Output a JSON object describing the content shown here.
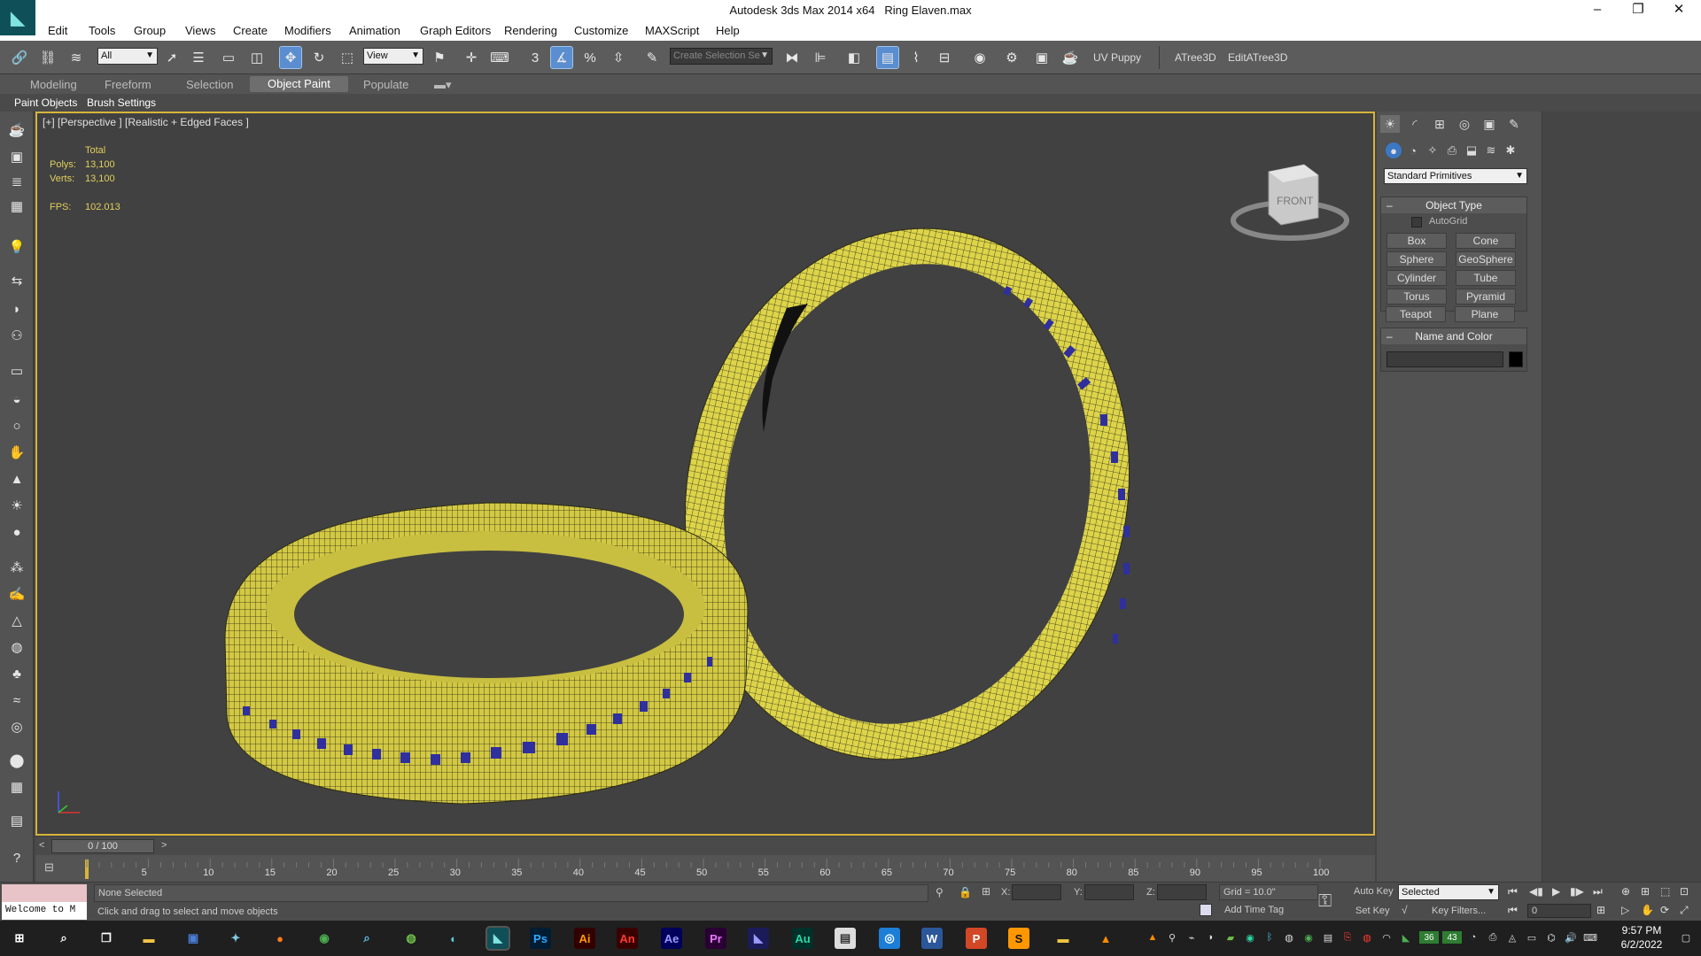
{
  "window": {
    "app_title": "Autodesk 3ds Max  2014 x64",
    "file_name": "Ring Elaven.max",
    "logo": "3ds-max-logo-icon"
  },
  "menu": [
    "Edit",
    "Tools",
    "Group",
    "Views",
    "Create",
    "Modifiers",
    "Animation",
    "Graph Editors",
    "Rendering",
    "Customize",
    "MAXScript",
    "Help"
  ],
  "toolbar": {
    "filter_value": "All",
    "coord_value": "View",
    "selection_set_placeholder": "Create Selection Se",
    "snap_label": "3",
    "angle_label": "",
    "percent_label": "%",
    "uv_puppy": "UV Puppy",
    "atree": "ATree3D",
    "editatree": "EditATree3D"
  },
  "ribbon": {
    "tabs": [
      "Modeling",
      "Freeform",
      "Selection",
      "Object Paint",
      "Populate"
    ],
    "active": "Object Paint",
    "sub": [
      "Paint Objects",
      "Brush Settings"
    ]
  },
  "viewport": {
    "label": "[+] [Perspective ] [Realistic + Edged Faces ]",
    "stats_total": "Total",
    "polys_label": "Polys:",
    "polys_value": "13,100",
    "verts_label": "Verts:",
    "verts_value": "13,100",
    "fps_label": "FPS:",
    "fps_value": "102.013",
    "viewcube_label": "FRONT",
    "colors": {
      "ring": "#ddd44a",
      "wire": "#2b2a14",
      "stone": "#2f2f9e",
      "bg": "#414141"
    }
  },
  "command_panel": {
    "dropdown": "Standard Primitives",
    "object_type_title": "Object Type",
    "autogrid": "AutoGrid",
    "primitives": [
      "Box",
      "Cone",
      "Sphere",
      "GeoSphere",
      "Cylinder",
      "Tube",
      "Torus",
      "Pyramid",
      "Teapot",
      "Plane"
    ],
    "name_color_title": "Name and Color",
    "name_value": ""
  },
  "timeline": {
    "frame": "0 / 100",
    "ticks": [
      "5",
      "10",
      "15",
      "20",
      "25",
      "30",
      "35",
      "40",
      "45",
      "50",
      "55",
      "60",
      "65",
      "70",
      "75",
      "80",
      "85",
      "90",
      "95",
      "100"
    ]
  },
  "status": {
    "maxscript": "Welcome to M",
    "selection": "None Selected",
    "prompt": "Click and drag to select and move objects",
    "x_label": "X:",
    "y_label": "Y:",
    "z_label": "Z:",
    "grid": "Grid = 10.0\"",
    "add_time_tag": "Add Time Tag",
    "auto_key": "Auto Key",
    "set_key": "Set Key",
    "key_mode": "Selected",
    "key_filters": "Key Filters...",
    "frame_value": "0"
  },
  "taskbar": {
    "apps": [
      "Ps",
      "Ai",
      "An",
      "Ae",
      "Pr",
      "Au"
    ],
    "time": "9:57 PM",
    "date": "6/2/2022",
    "tray_nums": [
      "36",
      "43"
    ]
  }
}
